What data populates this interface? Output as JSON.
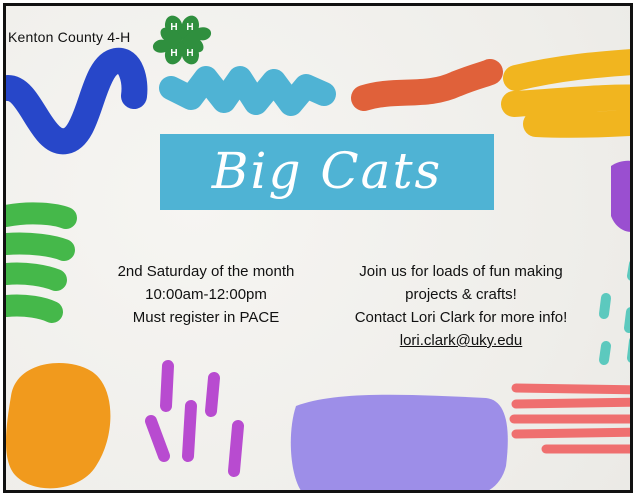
{
  "org_name": "Kenton County 4-H",
  "logo": {
    "icon": "four-leaf-clover-icon",
    "letter": "H",
    "color": "#2f8f3e"
  },
  "banner": {
    "title": "Big Cats",
    "color": "#4fb3d4"
  },
  "schedule": {
    "line1": "2nd Saturday of the month",
    "line2": "10:00am-12:00pm",
    "line3": "Must register in PACE"
  },
  "details": {
    "line1": "Join us for loads of fun making",
    "line2": "projects & crafts!",
    "line3": "Contact Lori Clark for more info!",
    "email": "lori.clark@uky.edu"
  },
  "colors": {
    "blue": "#2747c9",
    "light_blue": "#4fb3d4",
    "orange_red": "#e0613a",
    "yellow": "#f1b51f",
    "green": "#45b84a",
    "purple": "#9a4fd0",
    "orange": "#f19a1d",
    "magenta": "#b84bd0",
    "lavender": "#9d8ee8",
    "coral": "#ef6f6f",
    "teal": "#5cc9be"
  }
}
